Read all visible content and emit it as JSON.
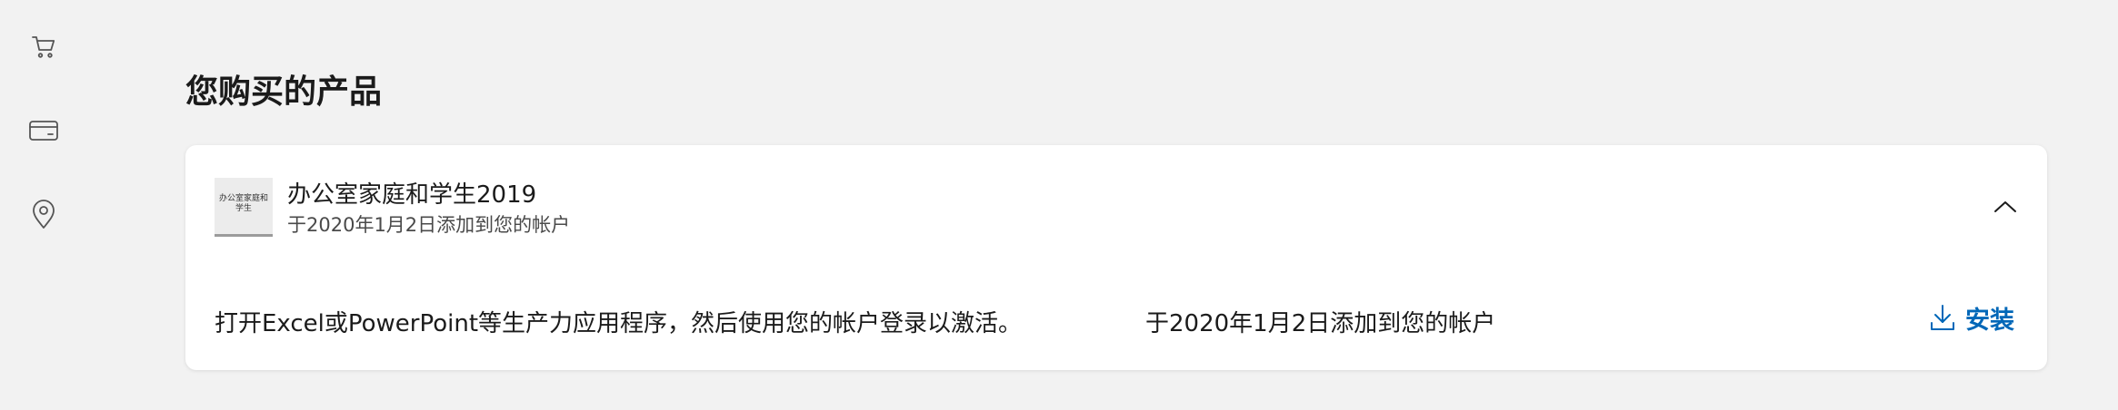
{
  "sidebar": {
    "items": [
      {
        "icon": "cart-icon"
      },
      {
        "icon": "credit-card-icon"
      },
      {
        "icon": "location-pin-icon"
      }
    ]
  },
  "page": {
    "title": "您购买的产品"
  },
  "product": {
    "thumbnail_text": "办公室家庭和学生",
    "name": "办公室家庭和学生2019",
    "subtitle": "于2020年1月2日添加到您的帐户",
    "instructions": "打开Excel或PowerPoint等生产力应用程序，然后使用您的帐户登录以激活。",
    "added_date": "于2020年1月2日添加到您的帐户",
    "install_label": "安装",
    "collapse_icon": "chevron-up-icon",
    "install_icon": "download-icon"
  },
  "colors": {
    "background": "#f2f2f2",
    "card": "#ffffff",
    "accent": "#0067b8",
    "text": "#1b1b1b",
    "muted_text": "#4a4a4a"
  }
}
